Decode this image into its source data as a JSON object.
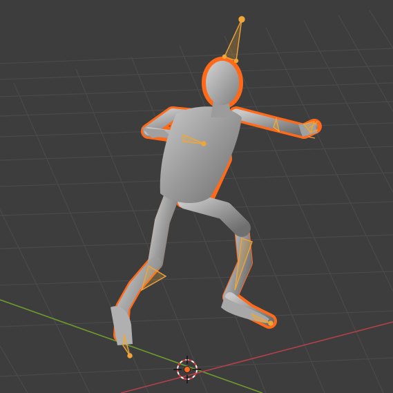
{
  "viewport": {
    "background": "#3d3d3d",
    "grid_color": "#4a4a4a",
    "x_axis_color": "#b4414a",
    "y_axis_color": "#6f9a2c",
    "selection_outline": "#ff6a1a",
    "armature_color": "#f0a637",
    "mesh_color": "#a8a8a8"
  },
  "icons": {
    "cursor": "3d-cursor-icon"
  },
  "objects": [
    {
      "name": "humanoid-mesh",
      "selected": true
    },
    {
      "name": "armature",
      "selected": true
    }
  ]
}
